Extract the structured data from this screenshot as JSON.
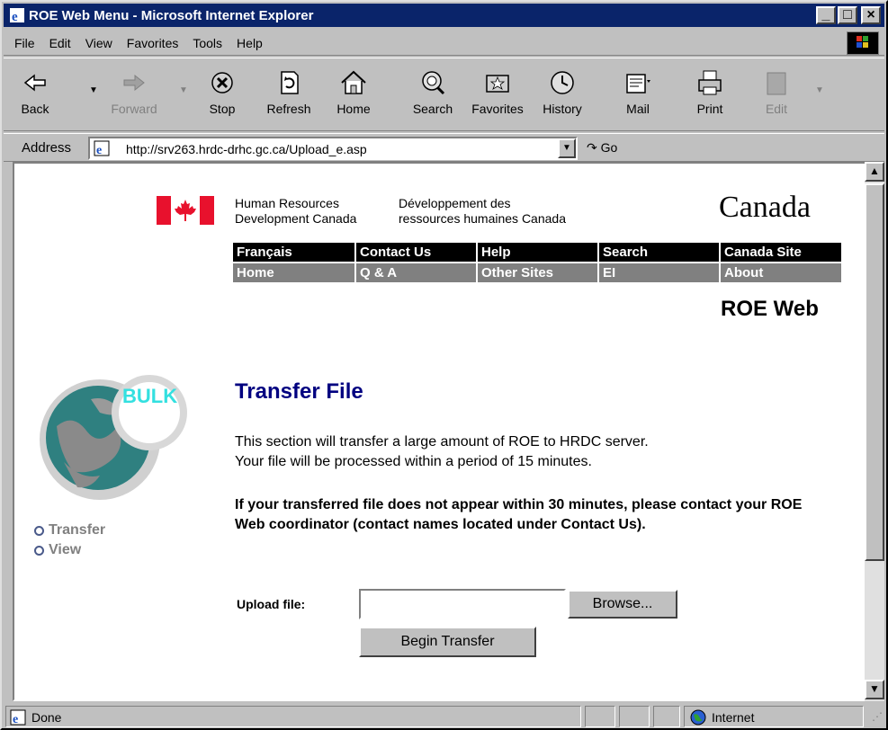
{
  "window": {
    "title": "ROE Web Menu - Microsoft Internet Explorer"
  },
  "menu": [
    "File",
    "Edit",
    "View",
    "Favorites",
    "Tools",
    "Help"
  ],
  "toolbar": {
    "back": "Back",
    "forward": "Forward",
    "stop": "Stop",
    "refresh": "Refresh",
    "home": "Home",
    "search": "Search",
    "favorites": "Favorites",
    "history": "History",
    "mail": "Mail",
    "print": "Print",
    "edit": "Edit"
  },
  "address": {
    "label": "Address",
    "url": "http://srv263.hrdc-drhc.gc.ca/Upload_e.asp",
    "go": "Go"
  },
  "header": {
    "dept_en_1": "Human Resources",
    "dept_en_2": "Development Canada",
    "dept_fr_1": "Développement des",
    "dept_fr_2": "ressources humaines Canada",
    "wordmark": "Canada"
  },
  "nav_top": [
    "Français",
    "Contact Us",
    "Help",
    "Search",
    "Canada Site"
  ],
  "nav_bottom": [
    "Home",
    "Q & A",
    "Other Sites",
    "EI",
    "About"
  ],
  "site_title": "ROE Web",
  "bulk_logo_text": "BULK",
  "side_nav": [
    "Transfer",
    "View"
  ],
  "main": {
    "heading": "Transfer File",
    "desc_1": "This section will transfer a large amount of ROE to HRDC server.",
    "desc_2": "Your file will be processed within a period of 15 minutes.",
    "warning": "If your transferred file does not appear within 30 minutes, please contact your ROE Web coordinator (contact names located under Contact Us).",
    "upload_label": "Upload file:",
    "upload_value": "",
    "browse": "Browse...",
    "begin": "Begin Transfer"
  },
  "status": {
    "text": "Done",
    "zone": "Internet"
  },
  "colors": {
    "title_bar": "#0a246a",
    "heading": "#000080",
    "flag_red": "#e8112d"
  }
}
